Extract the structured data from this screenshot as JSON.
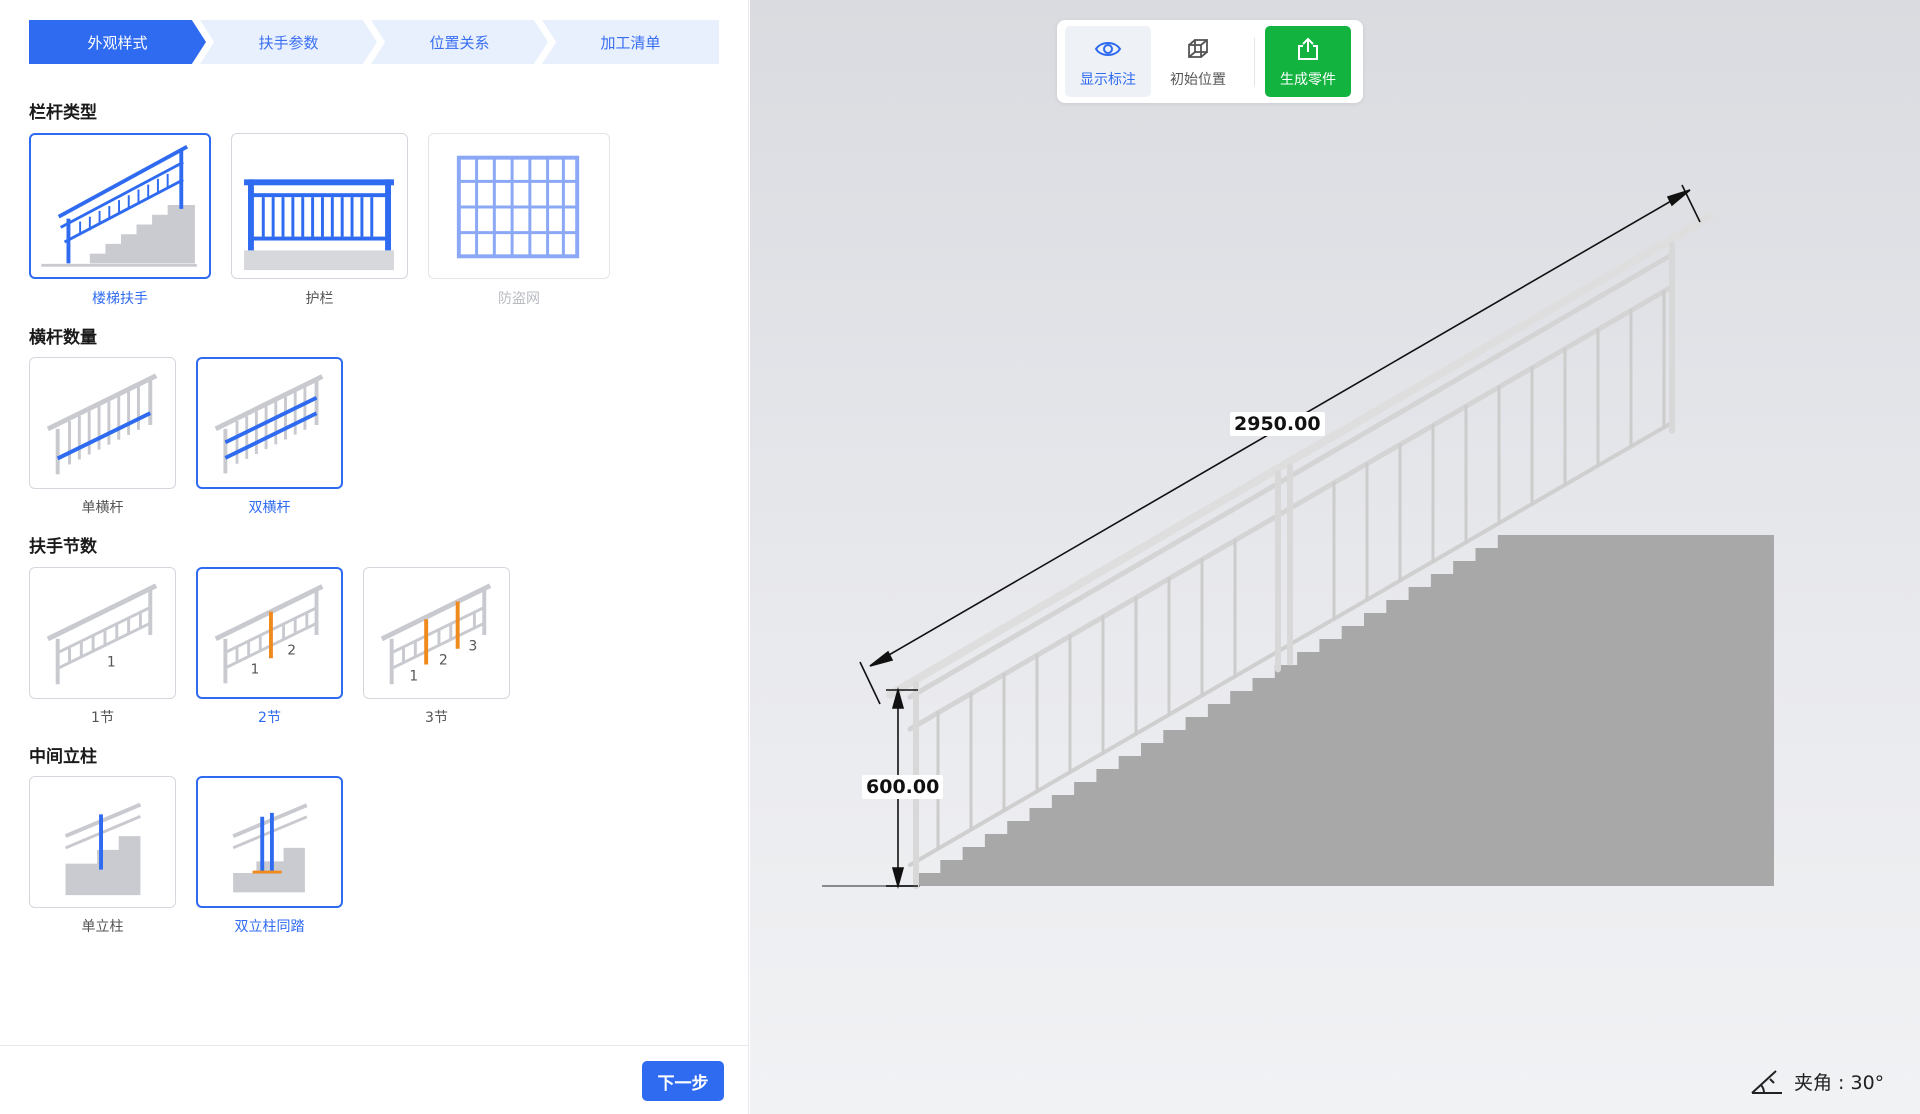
{
  "steps": [
    {
      "label": "外观样式",
      "active": true
    },
    {
      "label": "扶手参数",
      "active": false
    },
    {
      "label": "位置关系",
      "active": false
    },
    {
      "label": "加工清单",
      "active": false
    }
  ],
  "sections": {
    "railing_type": {
      "title": "栏杆类型",
      "options": [
        {
          "label": "楼梯扶手",
          "selected": true,
          "icon": "stair-railing-icon"
        },
        {
          "label": "护栏",
          "selected": false,
          "icon": "guardrail-icon"
        },
        {
          "label": "防盗网",
          "selected": false,
          "disabled": true,
          "icon": "security-grille-icon"
        }
      ]
    },
    "crossbar_count": {
      "title": "横杆数量",
      "options": [
        {
          "label": "单横杆",
          "selected": false,
          "icon": "single-crossbar-icon"
        },
        {
          "label": "双横杆",
          "selected": true,
          "icon": "double-crossbar-icon"
        }
      ]
    },
    "segment_count": {
      "title": "扶手节数",
      "options": [
        {
          "label": "1节",
          "selected": false,
          "icon": "one-segment-icon",
          "marks": [
            "1"
          ]
        },
        {
          "label": "2节",
          "selected": true,
          "icon": "two-segment-icon",
          "marks": [
            "1",
            "2"
          ]
        },
        {
          "label": "3节",
          "selected": false,
          "icon": "three-segment-icon",
          "marks": [
            "1",
            "2",
            "3"
          ]
        }
      ]
    },
    "middle_post": {
      "title": "中间立柱",
      "options": [
        {
          "label": "单立柱",
          "selected": false,
          "icon": "single-post-icon"
        },
        {
          "label": "双立柱同踏",
          "selected": true,
          "icon": "double-post-icon"
        }
      ]
    }
  },
  "footer": {
    "next_label": "下一步"
  },
  "toolbar": {
    "show_dimensions": {
      "label": "显示标注",
      "icon": "eye-icon",
      "active": true
    },
    "initial_position": {
      "label": "初始位置",
      "icon": "cube-icon"
    },
    "generate_parts": {
      "label": "生成零件",
      "icon": "export-icon"
    }
  },
  "viewport": {
    "length_dimension": "2950.00",
    "height_dimension": "600.00",
    "angle_label": "夹角 : 30°",
    "angle_icon": "angle-icon"
  },
  "colors": {
    "accent": "#2f6bf0",
    "step_inactive_bg": "#e8f0fd",
    "generate_green": "#12b33f",
    "highlight_orange": "#f08a1c",
    "stair_gray": "#a8a8a8"
  }
}
